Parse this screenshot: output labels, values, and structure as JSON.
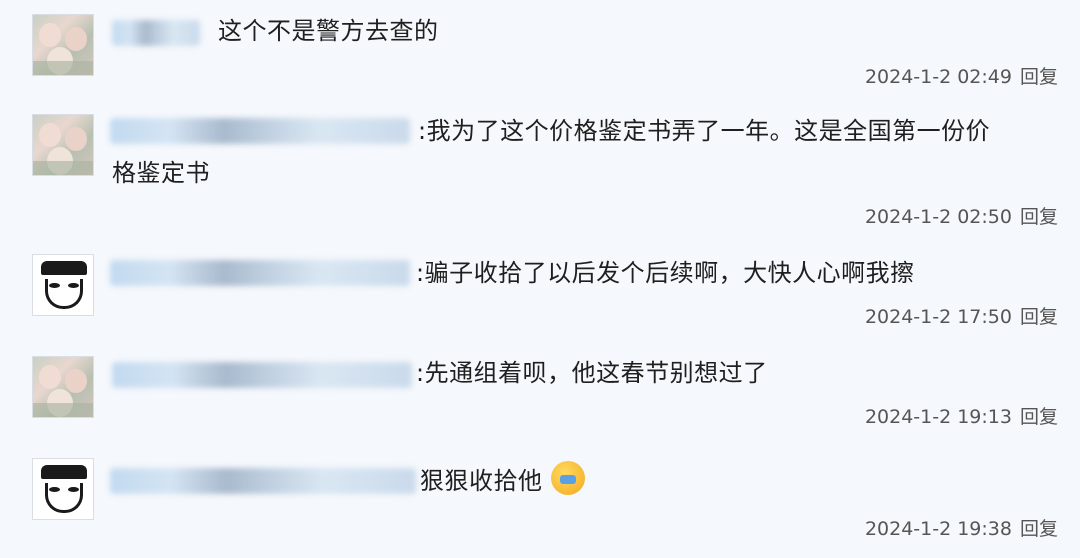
{
  "comments": [
    {
      "text": "这个不是警方去查的",
      "date": "2024-1-2 02:49",
      "reply": "回复",
      "avatar": "photo-avatar"
    },
    {
      "text_line1": ":我为了这个价格鉴定书弄了一年。这是全国第一份价",
      "text_line2": "格鉴定书",
      "date": "2024-1-2 02:50",
      "reply": "回复",
      "avatar": "photo-avatar"
    },
    {
      "text": ":骗子收拾了以后发个后续啊，大快人心啊我擦",
      "date": "2024-1-2 17:50",
      "reply": "回复",
      "avatar": "manga-avatar"
    },
    {
      "text": ":先通组着呗，他这春节别想过了",
      "date": "2024-1-2 19:13",
      "reply": "回复",
      "avatar": "photo-avatar"
    },
    {
      "text": "狠狠收拾他",
      "emoji": "angry-face-emoji",
      "date": "2024-1-2 19:38",
      "reply": "回复",
      "avatar": "manga-avatar"
    }
  ]
}
